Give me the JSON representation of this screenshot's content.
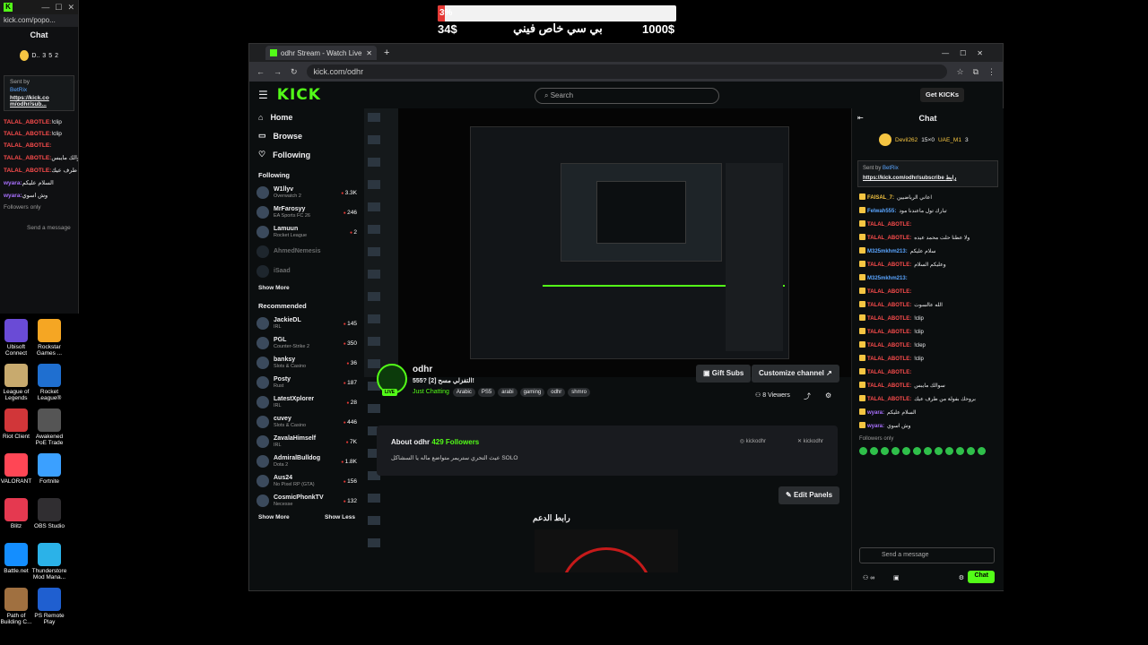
{
  "mini_window": {
    "url": "kick.com/popo...",
    "title": "Chat",
    "stats": [
      "D..",
      "3",
      "5",
      "2"
    ],
    "pinned": {
      "by": "Sent by",
      "user": "BetRix",
      "link": "https://kick.co m/odhr/sub..."
    },
    "lines": [
      {
        "user": "TALAL_ABOTLE:",
        "text": "!clip",
        "cls": "red"
      },
      {
        "user": "TALAL_ABOTLE:",
        "text": "!clip",
        "cls": "red"
      },
      {
        "user": "TALAL_ABOTLE:",
        "text": "",
        "cls": "red"
      },
      {
        "user": "TALAL_ABOTLE:",
        "text": "سوالك مايبس",
        "cls": "red"
      },
      {
        "user": "TALAL_ABOTLE:",
        "text": "بروحك بفولة من طرف عيك",
        "cls": "red"
      },
      {
        "user": "wyara:",
        "text": "السلام عليكم",
        "cls": "purp"
      },
      {
        "user": "wyara:",
        "text": "وش اسوي",
        "cls": "purp"
      }
    ],
    "followers_only": "Followers only",
    "send": "Send a message"
  },
  "goal": {
    "percent_label": "3%",
    "percent": 3,
    "left": "34$",
    "right": "1000$",
    "caption": "بي سي خاص فيني"
  },
  "browser": {
    "tab_title": "odhr Stream - Watch Live on Ki",
    "url": "kick.com/odhr"
  },
  "kick": {
    "logo": "KICK",
    "search_placeholder": "Search",
    "get_kicks": "Get KICKs",
    "nav": [
      {
        "label": "Home",
        "icon": "home-icon",
        "glyph": "⌂"
      },
      {
        "label": "Browse",
        "icon": "browse-icon",
        "glyph": "▭"
      },
      {
        "label": "Following",
        "icon": "heart-icon",
        "glyph": "♡"
      }
    ],
    "following_title": "Following",
    "following": [
      {
        "name": "W1llyv",
        "game": "Overwatch 2",
        "count": "3.3K",
        "off": false
      },
      {
        "name": "MrFarosyy",
        "game": "EA Sports FC 26",
        "count": "246",
        "off": false
      },
      {
        "name": "Lamuun",
        "game": "Rocket League",
        "count": "2",
        "off": false
      },
      {
        "name": "AhmedNemesis",
        "game": "",
        "count": "",
        "off": true
      },
      {
        "name": "iSaad",
        "game": "",
        "count": "",
        "off": true
      }
    ],
    "show_more": "Show More",
    "recommended_title": "Recommended",
    "recommended": [
      {
        "name": "JackieDL",
        "game": "IRL",
        "count": "145"
      },
      {
        "name": "PGL",
        "game": "Counter-Strike 2",
        "count": "350"
      },
      {
        "name": "banksy",
        "game": "Slots & Casino",
        "count": "36"
      },
      {
        "name": "Posty",
        "game": "Rust",
        "count": "187"
      },
      {
        "name": "LatestXplorer",
        "game": "IRL",
        "count": "28"
      },
      {
        "name": "cuvey",
        "game": "Slots & Casino",
        "count": "446"
      },
      {
        "name": "ZavalaHimself",
        "game": "IRL",
        "count": "7K"
      },
      {
        "name": "AdmiralBulldog",
        "game": "Dota 2",
        "count": "1.8K"
      },
      {
        "name": "Aus24",
        "game": "No Pixel RP (GTA)",
        "count": "156"
      },
      {
        "name": "CosmicPhonkTV",
        "game": "Necesse",
        "count": "132"
      }
    ],
    "show_more2": "Show More",
    "show_less": "Show Less",
    "stream": {
      "channel": "odhr",
      "title": "555? [2] التفزلي مسح!",
      "category": "Just Chatting",
      "tags": [
        "Arabic",
        "PS5",
        "arabi",
        "gaming",
        "odhr",
        "shmro"
      ],
      "viewers": "8 Viewers",
      "gift_subs": "Gift Subs",
      "customize": "Customize channel",
      "live": "LIVE"
    },
    "about": {
      "title": "About odhr",
      "followers": "429 Followers",
      "desc": "عيث التحري ستريمر متواضع ماله يا السشاكل SOLO",
      "social1": "kickodhr",
      "social2": "kickodhr"
    },
    "edit_panels": "Edit Panels",
    "support_link": "رابط الدعم",
    "chat": {
      "title": "Chat",
      "top_users": [
        {
          "name": "Devil262",
          "stat": "15×0"
        },
        {
          "name": "UAE_M1",
          "stat": "3"
        }
      ],
      "pinned_by": "Sent by",
      "pinned_user": "BetRix",
      "pinned_link": "https://kick.com/odhr/subscribe رابط",
      "messages": [
        {
          "user": "FAISAL_7:",
          "text": "اعاني الرياضيين",
          "cls": "ylw"
        },
        {
          "user": "Felwah555:",
          "text": "تبارك تول ماعندنا مود",
          "cls": "blu"
        },
        {
          "user": "TALAL_ABOTLE:",
          "text": "",
          "cls": "red"
        },
        {
          "user": "TALAL_ABOTLE:",
          "text": "ولا عطنا حلت محمد عيده",
          "cls": "red"
        },
        {
          "user": "M325mkhm213:",
          "text": "سلام عليكم",
          "cls": "blu"
        },
        {
          "user": "TALAL_ABOTLE:",
          "text": "وعليكم السلام",
          "cls": "red"
        },
        {
          "user": "M325mkhm213:",
          "text": "",
          "cls": "blu"
        },
        {
          "user": "TALAL_ABOTLE:",
          "text": "",
          "cls": "red"
        },
        {
          "user": "TALAL_ABOTLE:",
          "text": "الله عالسوت",
          "cls": "red"
        },
        {
          "user": "TALAL_ABOTLE:",
          "text": "!clip",
          "cls": "red"
        },
        {
          "user": "TALAL_ABOTLE:",
          "text": "!clip",
          "cls": "red"
        },
        {
          "user": "TALAL_ABOTLE:",
          "text": "!clep",
          "cls": "red"
        },
        {
          "user": "TALAL_ABOTLE:",
          "text": "!clip",
          "cls": "red"
        },
        {
          "user": "TALAL_ABOTLE:",
          "text": "",
          "cls": "red"
        },
        {
          "user": "TALAL_ABOTLE:",
          "text": "سوالك مايبس",
          "cls": "red"
        },
        {
          "user": "TALAL_ABOTLE:",
          "text": "بروحك بفولة من طرف عيك",
          "cls": "red"
        },
        {
          "user": "wyara:",
          "text": "السلام عليكم",
          "cls": "purp"
        },
        {
          "user": "wyara:",
          "text": "وش اسوي",
          "cls": "purp"
        }
      ],
      "followers_only": "Followers only",
      "send_placeholder": "Send a message",
      "chat_button": "Chat"
    }
  },
  "desktop_icons": [
    {
      "label": "Ubisoft Connect",
      "color": "#6a4bd6",
      "icon": "ubisoft-icon"
    },
    {
      "label": "Rockstar Games ...",
      "color": "#f5a623",
      "icon": "rockstar-icon"
    },
    {
      "label": "League of Legends",
      "color": "#c8aa6e",
      "icon": "lol-icon"
    },
    {
      "label": "Rocket League®",
      "color": "#1f6fd0",
      "icon": "rocket-league-icon"
    },
    {
      "label": "Riot Client",
      "color": "#d13639",
      "icon": "riot-icon"
    },
    {
      "label": "Awakened PoE Trade",
      "color": "#555",
      "icon": "poe-trade-icon"
    },
    {
      "label": "VALORANT",
      "color": "#ff4655",
      "icon": "valorant-icon"
    },
    {
      "label": "Fortnite",
      "color": "#3ba0ff",
      "icon": "fortnite-icon"
    },
    {
      "label": "Blitz",
      "color": "#e53950",
      "icon": "blitz-icon"
    },
    {
      "label": "OBS Studio",
      "color": "#302e31",
      "icon": "obs-icon"
    },
    {
      "label": "Battle.net",
      "color": "#148eff",
      "icon": "battlenet-icon"
    },
    {
      "label": "Thunderstore Mod Mana...",
      "color": "#2bb2e8",
      "icon": "thunderstore-icon"
    },
    {
      "label": "Path of Building C...",
      "color": "#a07040",
      "icon": "pob-icon"
    },
    {
      "label": "PS Remote Play",
      "color": "#1f5fd0",
      "icon": "ps-remote-icon"
    }
  ]
}
